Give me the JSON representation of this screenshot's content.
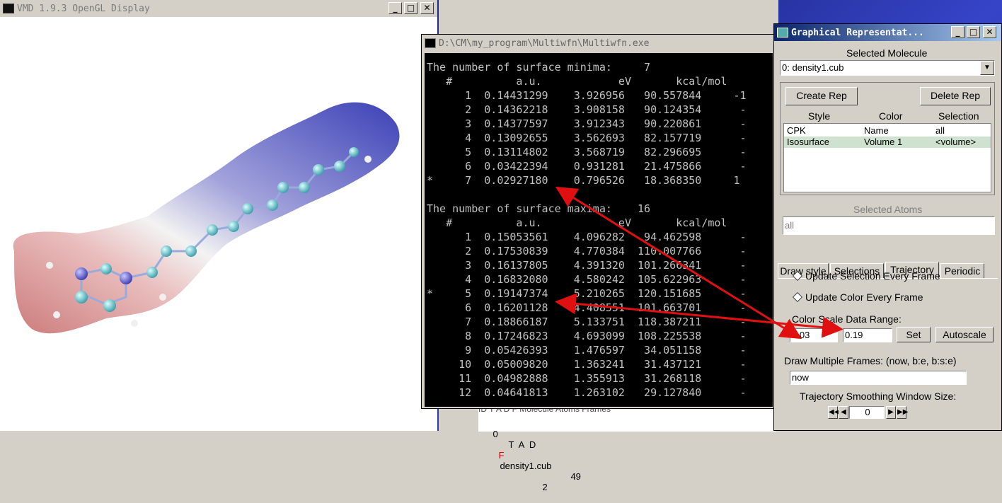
{
  "gl_window": {
    "title": "VMD 1.9.3 OpenGL Display"
  },
  "console_window": {
    "title": "D:\\CM\\my_program\\Multiwfn\\Multiwfn.exe",
    "minima_header": "The number of surface minima:     7",
    "columns": "   #          a.u.            eV       kcal/mol",
    "minima": [
      "      1  0.14431299    3.926956   90.557844     -1",
      "      2  0.14362218    3.908158   90.124354      -",
      "      3  0.14377597    3.912343   90.220861      -",
      "      4  0.13092655    3.562693   82.157719      -",
      "      5  0.13114802    3.568719   82.296695      -",
      "      6  0.03422394    0.931281   21.475866      -",
      "*     7  0.02927180    0.796526   18.368350     1"
    ],
    "maxima_header": "The number of surface maxima:    16",
    "maxima": [
      "      1  0.15053561    4.096282   94.462598      -",
      "      2  0.17530839    4.770384  110.007766      -",
      "      3  0.16137805    4.391320  101.266341      -",
      "      4  0.16832080    4.580242  105.622963      -",
      "*     5  0.19147374    5.210265  120.151685      -",
      "      6  0.16201128    4.408551  101.663701      -",
      "      7  0.18866187    5.133751  118.387211      -",
      "      8  0.17246823    4.693099  108.225538      -",
      "      9  0.05426393    1.476597   34.051158      -",
      "     10  0.05009820    1.363241   31.437121      -",
      "     11  0.04982888    1.355913   31.268118      -",
      "     12  0.04641813    1.263102   29.127840      -"
    ]
  },
  "vmd_main_list": {
    "header": "ID  T  A  D  F  Molecule                    Atoms      Frames",
    "row": {
      "id": "0",
      "flags": "T  A  D",
      "f": "F",
      "molecule": "density1.cub",
      "atoms": "49",
      "frames": "2"
    }
  },
  "rep_window": {
    "title": "Graphical Representat...",
    "selected_molecule_label": "Selected Molecule",
    "selected_molecule": "0: density1.cub",
    "create_rep": "Create Rep",
    "delete_rep": "Delete Rep",
    "table_headers": [
      "Style",
      "Color",
      "Selection"
    ],
    "reps": [
      {
        "style": "CPK",
        "color": "Name",
        "selection": "all"
      },
      {
        "style": "Isosurface",
        "color": "Volume 1",
        "selection": "<volume>"
      }
    ],
    "selected_atoms_label": "Selected Atoms",
    "selected_atoms_value": "all",
    "tabs": [
      "Draw style",
      "Selections",
      "Trajectory",
      "Periodic"
    ],
    "active_tab": "Trajectory",
    "update_selection": "Update Selection Every Frame",
    "update_color": "Update Color Every Frame",
    "color_scale_label": "Color Scale Data Range:",
    "range_min": "0.03",
    "range_max": "0.19",
    "set_button": "Set",
    "autoscale_button": "Autoscale",
    "multiple_frames_label": "Draw Multiple Frames: (now, b:e, b:s:e)",
    "multiple_frames_value": "now",
    "smoothing_label": "Trajectory Smoothing Window Size:",
    "smoothing_value": "0"
  },
  "colors": {
    "accent_title": "#0a246a",
    "arrow": "#e01010",
    "console_bg": "#000000"
  }
}
